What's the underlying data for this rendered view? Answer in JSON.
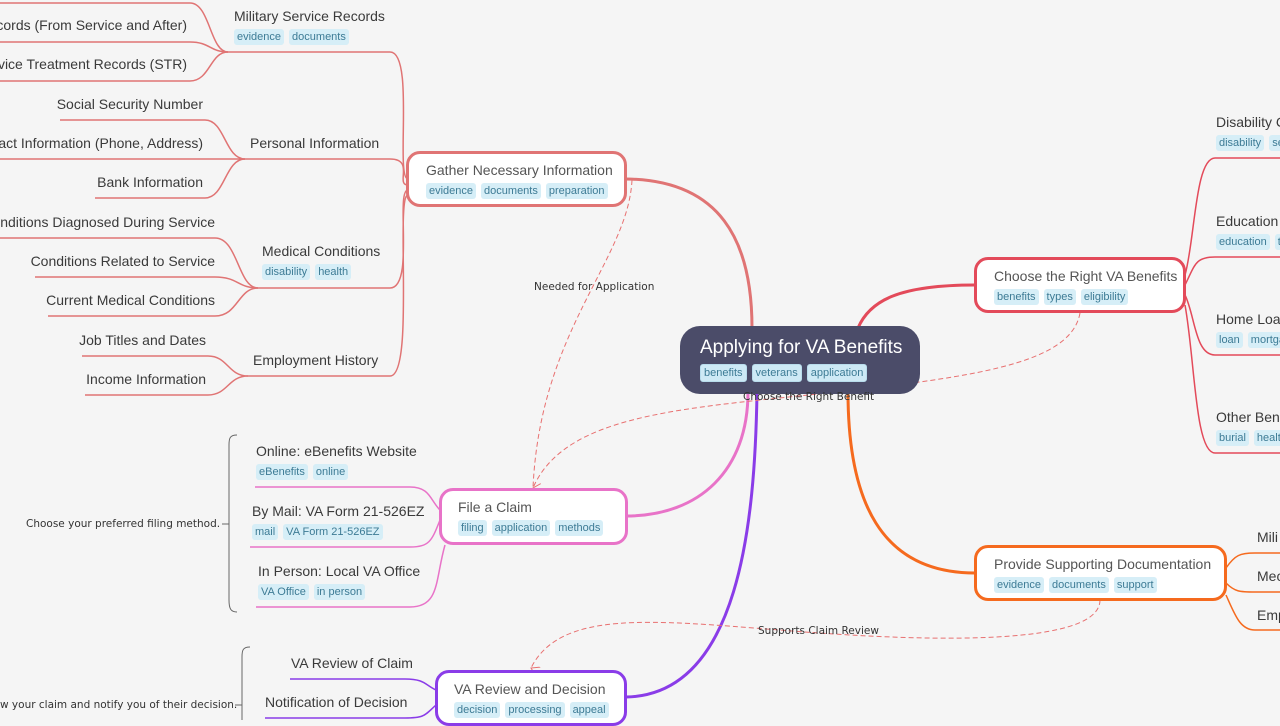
{
  "root": {
    "title": "Applying for VA Benefits",
    "tags": [
      "benefits",
      "veterans",
      "application"
    ],
    "color": "#4b4c69"
  },
  "branches": {
    "gather": {
      "title": "Gather Necessary Information",
      "tags": [
        "evidence",
        "documents",
        "preparation"
      ],
      "color": "#e07474",
      "children": {
        "military": {
          "title": "Military Service Records",
          "tags": [
            "evidence",
            "documents"
          ],
          "items": [
            "Records (From Service and After)",
            "Service Treatment Records (STR)"
          ]
        },
        "personal": {
          "title": "Personal Information",
          "items": [
            "Social Security Number",
            "Contact Information (Phone, Address)",
            "Bank Information"
          ]
        },
        "medical": {
          "title": "Medical Conditions",
          "tags": [
            "disability",
            "health"
          ],
          "items": [
            "Conditions Diagnosed During Service",
            "Conditions Related to Service",
            "Current Medical Conditions"
          ]
        },
        "employment": {
          "title": "Employment History",
          "items": [
            "Job Titles and Dates",
            "Income Information"
          ]
        }
      }
    },
    "choose": {
      "title": "Choose the Right VA Benefits",
      "tags": [
        "benefits",
        "types",
        "eligibility"
      ],
      "color": "#e34a5a",
      "children": [
        {
          "title": "Disability C",
          "tags": [
            "disability",
            "se"
          ]
        },
        {
          "title": "Education",
          "tags": [
            "education",
            "t"
          ]
        },
        {
          "title": "Home Loar",
          "tags": [
            "loan",
            "mortga"
          ]
        },
        {
          "title": "Other Bene",
          "tags": [
            "burial",
            "healt"
          ]
        }
      ]
    },
    "file": {
      "title": "File a Claim",
      "tags": [
        "filing",
        "application",
        "methods"
      ],
      "color": "#e873c8",
      "note": "Choose your preferred filing method.",
      "children": [
        {
          "title": "Online: eBenefits Website",
          "tags": [
            "eBenefits",
            "online"
          ]
        },
        {
          "title": "By Mail: VA Form 21-526EZ",
          "tags": [
            "mail",
            "VA Form 21-526EZ"
          ]
        },
        {
          "title": "In Person: Local VA Office",
          "tags": [
            "VA Office",
            "in person"
          ]
        }
      ]
    },
    "support": {
      "title": "Provide Supporting Documentation",
      "tags": [
        "evidence",
        "documents",
        "support"
      ],
      "color": "#f56a1e",
      "children": [
        "Mili",
        "Mec",
        "Emp"
      ]
    },
    "review": {
      "title": "VA Review and Decision",
      "tags": [
        "decision",
        "processing",
        "appeal"
      ],
      "color": "#8a3ce8",
      "note": "w your claim and notify you of their decision.",
      "children": [
        "VA Review of Claim",
        "Notification of Decision"
      ]
    }
  },
  "relations": {
    "needed": "Needed for Application",
    "choose": "Choose the Right Benefit",
    "supports": "Supports Claim Review"
  }
}
